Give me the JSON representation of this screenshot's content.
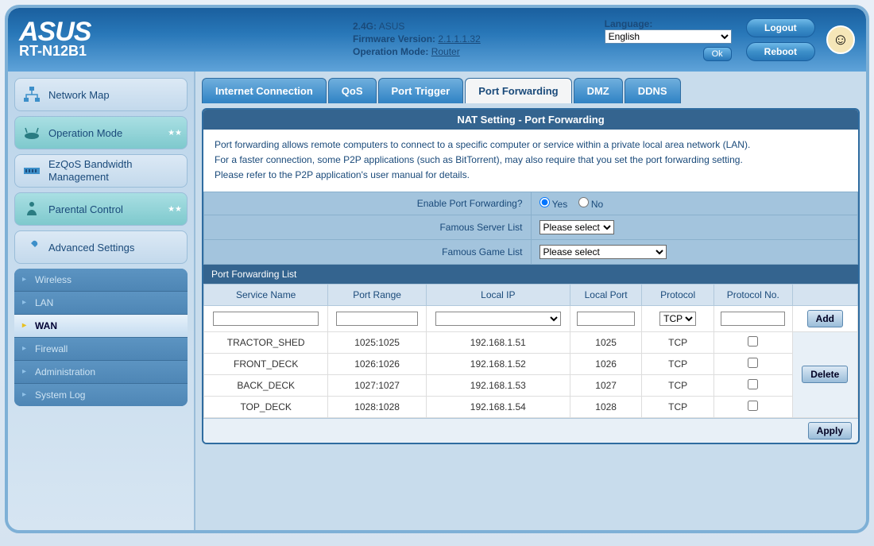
{
  "brand": "ASUS",
  "model": "RT-N12B1",
  "header": {
    "ssid_label": "2.4G:",
    "ssid": "ASUS",
    "fw_label": "Firmware Version:",
    "fw": "2.1.1.1.32",
    "mode_label": "Operation Mode:",
    "mode": "Router",
    "lang_label": "Language:",
    "lang_value": "English",
    "ok": "Ok",
    "logout": "Logout",
    "reboot": "Reboot"
  },
  "sidebar": {
    "main": [
      {
        "label": "Network Map"
      },
      {
        "label": "Operation Mode"
      },
      {
        "label": "EzQoS Bandwidth Management"
      },
      {
        "label": "Parental Control"
      },
      {
        "label": "Advanced Settings"
      }
    ],
    "sub": [
      {
        "label": "Wireless"
      },
      {
        "label": "LAN"
      },
      {
        "label": "WAN"
      },
      {
        "label": "Firewall"
      },
      {
        "label": "Administration"
      },
      {
        "label": "System Log"
      }
    ],
    "active_sub": "WAN"
  },
  "tabs": [
    "Internet Connection",
    "QoS",
    "Port Trigger",
    "Port Forwarding",
    "DMZ",
    "DDNS"
  ],
  "active_tab": "Port Forwarding",
  "page": {
    "title": "NAT Setting - Port Forwarding",
    "desc1": "Port forwarding allows remote computers to connect to a specific computer or service within a private local area network (LAN).",
    "desc2": "For a faster connection, some P2P applications (such as BitTorrent), may also require that you set the port forwarding setting.",
    "desc3": "Please refer to the P2P application's user manual for details.",
    "enable_label": "Enable Port Forwarding?",
    "yes": "Yes",
    "no": "No",
    "enable_value": "yes",
    "server_list_label": "Famous Server List",
    "server_list_value": "Please select",
    "game_list_label": "Famous Game List",
    "game_list_value": "Please select",
    "list_header": "Port Forwarding List",
    "cols": [
      "Service Name",
      "Port Range",
      "Local IP",
      "Local Port",
      "Protocol",
      "Protocol No."
    ],
    "protocol_input": "TCP",
    "add": "Add",
    "delete": "Delete",
    "apply": "Apply",
    "rows": [
      {
        "name": "TRACTOR_SHED",
        "range": "1025:1025",
        "ip": "192.168.1.51",
        "port": "1025",
        "proto": "TCP",
        "pno": ""
      },
      {
        "name": "FRONT_DECK",
        "range": "1026:1026",
        "ip": "192.168.1.52",
        "port": "1026",
        "proto": "TCP",
        "pno": ""
      },
      {
        "name": "BACK_DECK",
        "range": "1027:1027",
        "ip": "192.168.1.53",
        "port": "1027",
        "proto": "TCP",
        "pno": ""
      },
      {
        "name": "TOP_DECK",
        "range": "1028:1028",
        "ip": "192.168.1.54",
        "port": "1028",
        "proto": "TCP",
        "pno": ""
      }
    ]
  }
}
